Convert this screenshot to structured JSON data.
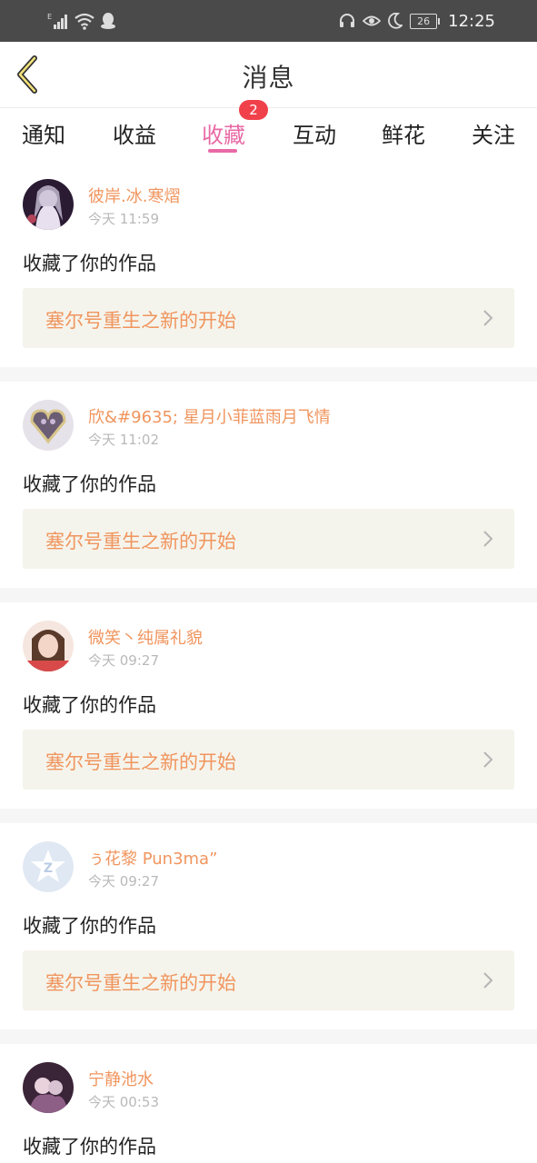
{
  "status_bar": {
    "left_icons": [
      "signal-icon",
      "wifi-icon",
      "qq-icon"
    ],
    "right_icons": [
      "headphones-icon",
      "eye-icon",
      "moon-icon"
    ],
    "battery": "26",
    "time": "12:25"
  },
  "header": {
    "title": "消息"
  },
  "tabs": [
    {
      "label": "通知"
    },
    {
      "label": "收益"
    },
    {
      "label": "收藏",
      "active": true,
      "badge": "2"
    },
    {
      "label": "互动"
    },
    {
      "label": "鲜花"
    },
    {
      "label": "关注"
    }
  ],
  "messages": [
    {
      "user": "彼岸.冰.寒熠",
      "time": "今天 11:59",
      "action": "收藏了你的作品",
      "work": "塞尔号重生之新的开始"
    },
    {
      "user": "欣&#9635; 星月小菲蓝雨月飞情",
      "time": "今天 11:02",
      "action": "收藏了你的作品",
      "work": "塞尔号重生之新的开始"
    },
    {
      "user": "微笑丶纯属礼貌",
      "time": "今天 09:27",
      "action": "收藏了你的作品",
      "work": "塞尔号重生之新的开始"
    },
    {
      "user": "ぅ花黎 Pun3ma”",
      "time": "今天 09:27",
      "action": "收藏了你的作品",
      "work": "塞尔号重生之新的开始"
    },
    {
      "user": "宁静池水",
      "time": "今天 00:53",
      "action": "收藏了你的作品",
      "work": ""
    }
  ],
  "colors": {
    "accent": "#e86aa6",
    "username": "#f0955e",
    "badge": "#f0414b",
    "work_bg": "#f5f4ec"
  }
}
